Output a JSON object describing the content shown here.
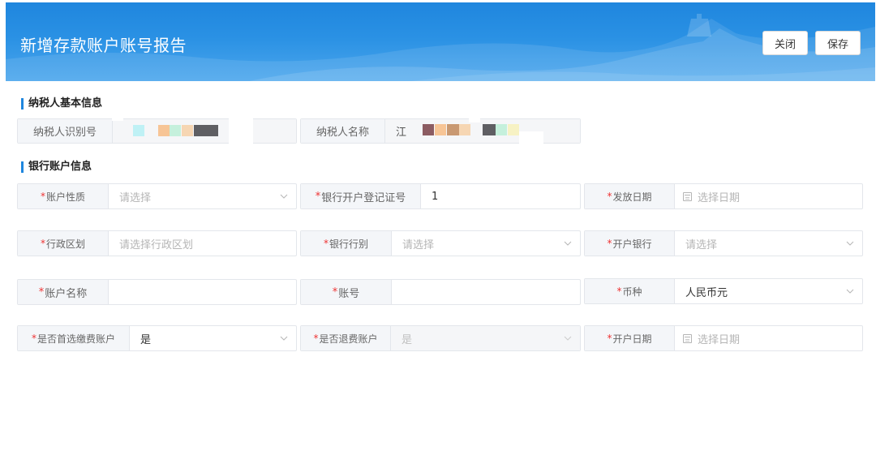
{
  "header": {
    "title": "新增存款账户账号报告",
    "close_label": "关闭",
    "save_label": "保存"
  },
  "taxpayer_section": {
    "title": "纳税人基本信息",
    "id_label": "纳税人识别号",
    "name_label": "纳税人名称",
    "name_value_visible": "江"
  },
  "bank_section": {
    "title": "银行账户信息",
    "required_mark": "*",
    "account_type": {
      "label": "账户性质",
      "placeholder": "请选择"
    },
    "reg_cert": {
      "label": "银行开户登记证号",
      "value": "1"
    },
    "issue_date": {
      "label": "发放日期",
      "placeholder": "选择日期"
    },
    "admin_region": {
      "label": "行政区划",
      "placeholder": "请选择行政区划"
    },
    "bank_type": {
      "label": "银行行别",
      "placeholder": "请选择"
    },
    "open_bank": {
      "label": "开户银行",
      "placeholder": "请选择"
    },
    "account_name": {
      "label": "账户名称",
      "value": ""
    },
    "account_number": {
      "label": "账号",
      "value": ""
    },
    "currency": {
      "label": "币种",
      "value": "人民币元"
    },
    "preferred_fee": {
      "label": "是否首选缴费账户",
      "value": "是"
    },
    "refund": {
      "label": "是否退费账户",
      "value": "是"
    },
    "open_date": {
      "label": "开户日期",
      "placeholder": "选择日期"
    }
  },
  "colors": {
    "header_blue": "#1f86de",
    "required_red": "#e33333",
    "label_bg": "#f4f6f9"
  }
}
